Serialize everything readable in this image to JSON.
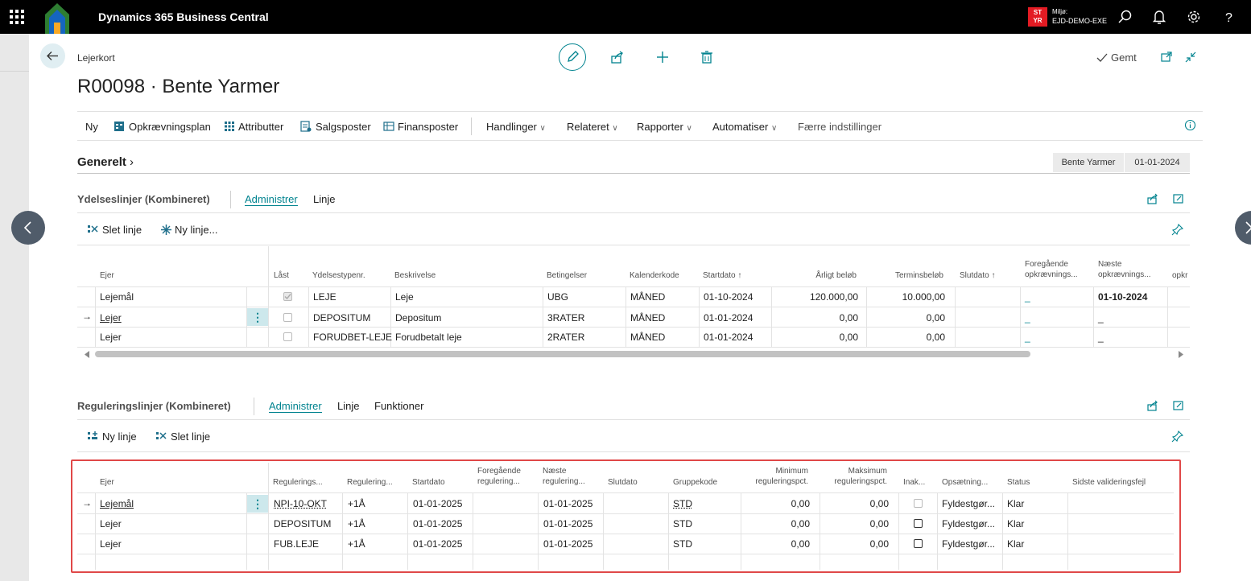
{
  "app": {
    "title": "Dynamics 365 Business Central"
  },
  "environment": {
    "badge_line1": "ST",
    "badge_line2": "YR",
    "label": "Miljø:",
    "name": "EJD-DEMO-EXE",
    "badge_color": "#e31b23"
  },
  "page": {
    "breadcrumb": "Lejerkort",
    "title": "R00098 · Bente Yarmer",
    "saved_status": "Gemt"
  },
  "actionbar": {
    "items": [
      "Ny",
      "Opkrævningsplan",
      "Attributter",
      "Salgsposter",
      "Finansposter"
    ],
    "menus": [
      "Handlinger",
      "Relateret",
      "Rapporter",
      "Automatiser"
    ],
    "fewer": "Færre indstillinger"
  },
  "general": {
    "title": "Generelt",
    "facts": [
      "Bente Yarmer",
      "01-01-2024"
    ]
  },
  "ydelseslinjer": {
    "title": "Ydelseslinjer (Kombineret)",
    "tabs": [
      "Administrer",
      "Linje"
    ],
    "actions": [
      "Slet linje",
      "Ny linje..."
    ],
    "columns": {
      "ejer": "Ejer",
      "laast": "Låst",
      "ydelsestype": "Ydelsestypenr.",
      "beskrivelse": "Beskrivelse",
      "betingelser": "Betingelser",
      "kalenderkode": "Kalenderkode",
      "startdato": "Startdato",
      "aarligt": "Årligt beløb",
      "termin": "Terminsbeløb",
      "slutdato": "Slutdato",
      "foregaaende1": "Foregående",
      "foregaaende2": "opkrævnings...",
      "naeste1": "Næste",
      "naeste2": "opkrævnings...",
      "opkr": "opkr"
    },
    "rows": [
      {
        "ejer": "Lejemål",
        "laast": true,
        "type": "LEJE",
        "beskrivelse": "Leje",
        "betingelser": "UBG",
        "kalender": "MÅNED",
        "start": "01-10-2024",
        "aarligt": "120.000,00",
        "termin": "10.000,00",
        "slut": "",
        "foregaaende": "_",
        "naeste": "01-10-2024"
      },
      {
        "ejer": "Lejer",
        "laast": false,
        "type": "DEPOSITUM",
        "beskrivelse": "Depositum",
        "betingelser": "3RATER",
        "kalender": "MÅNED",
        "start": "01-01-2024",
        "aarligt": "0,00",
        "termin": "0,00",
        "slut": "",
        "foregaaende": "_",
        "naeste": "_"
      },
      {
        "ejer": "Lejer",
        "laast": false,
        "type": "FORUDBET-LEJE",
        "beskrivelse": "Forudbetalt leje",
        "betingelser": "2RATER",
        "kalender": "MÅNED",
        "start": "01-01-2024",
        "aarligt": "0,00",
        "termin": "0,00",
        "slut": "",
        "foregaaende": "_",
        "naeste": "_"
      }
    ]
  },
  "reguleringslinjer": {
    "title": "Reguleringslinjer (Kombineret)",
    "tabs": [
      "Administrer",
      "Linje",
      "Funktioner"
    ],
    "actions": [
      "Ny linje",
      "Slet linje"
    ],
    "columns": {
      "ejer": "Ejer",
      "regulering1": "Regulerings...",
      "regulering2": "Regulering...",
      "startdato": "Startdato",
      "foregaaende1": "Foregående",
      "foregaaende2": "regulering...",
      "naeste1": "Næste",
      "naeste2": "regulering...",
      "slutdato": "Slutdato",
      "gruppekode": "Gruppekode",
      "min1": "Minimum",
      "min2": "reguleringspct.",
      "max1": "Maksimum",
      "max2": "reguleringspct.",
      "inak": "Inak...",
      "opsaetning": "Opsætning...",
      "status": "Status",
      "fejl": "Sidste valideringsfejl"
    },
    "rows": [
      {
        "ejer": "Lejemål",
        "reg1": "NPI-10-OKT",
        "reg2": "+1Å",
        "start": "01-01-2025",
        "foregaaende": "",
        "naeste": "01-01-2025",
        "slut": "",
        "gruppe": "STD",
        "min": "0,00",
        "max": "0,00",
        "inaktiv": false,
        "opsaetning": "Fyldestgør...",
        "status": "Klar",
        "fejl": ""
      },
      {
        "ejer": "Lejer",
        "reg1": "DEPOSITUM",
        "reg2": "+1Å",
        "start": "01-01-2025",
        "foregaaende": "",
        "naeste": "01-01-2025",
        "slut": "",
        "gruppe": "STD",
        "min": "0,00",
        "max": "0,00",
        "inaktiv": false,
        "opsaetning": "Fyldestgør...",
        "status": "Klar",
        "fejl": ""
      },
      {
        "ejer": "Lejer",
        "reg1": "FUB.LEJE",
        "reg2": "+1Å",
        "start": "01-01-2025",
        "foregaaende": "",
        "naeste": "01-01-2025",
        "slut": "",
        "gruppe": "STD",
        "min": "0,00",
        "max": "0,00",
        "inaktiv": false,
        "opsaetning": "Fyldestgør...",
        "status": "Klar",
        "fejl": ""
      }
    ]
  },
  "colors": {
    "accent": "#00838f",
    "highlight": "#e04848",
    "topbar": "#000000"
  }
}
